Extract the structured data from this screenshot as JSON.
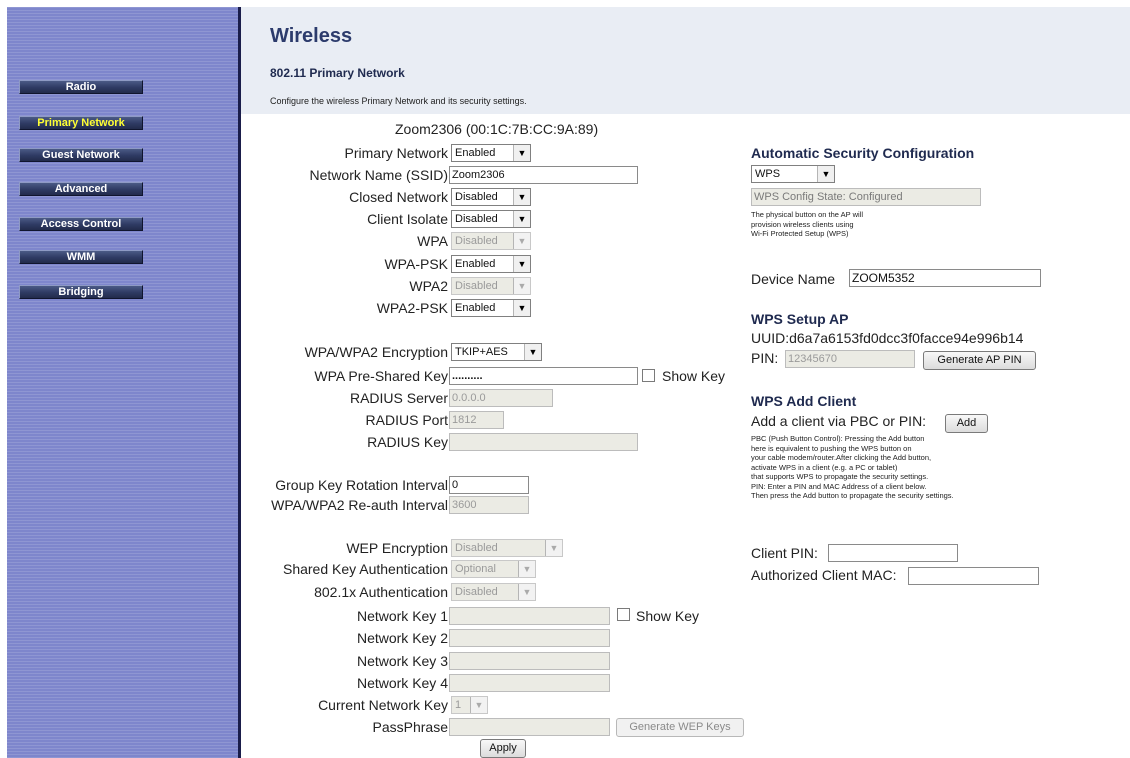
{
  "sidebar": {
    "items": [
      {
        "label": "Radio",
        "active": false
      },
      {
        "label": "Primary Network",
        "active": true
      },
      {
        "label": "Guest Network",
        "active": false
      },
      {
        "label": "Advanced",
        "active": false
      },
      {
        "label": "Access Control",
        "active": false
      },
      {
        "label": "WMM",
        "active": false
      },
      {
        "label": "Bridging",
        "active": false
      }
    ]
  },
  "header": {
    "title": "Wireless",
    "section": "802.11 Primary Network",
    "description": "Configure the wireless Primary Network and its security settings."
  },
  "form": {
    "network_info": "Zoom2306 (00:1C:7B:CC:9A:89)",
    "primary_network": {
      "label": "Primary Network",
      "value": "Enabled"
    },
    "ssid": {
      "label": "Network Name (SSID)",
      "value": "Zoom2306"
    },
    "closed_network": {
      "label": "Closed Network",
      "value": "Disabled"
    },
    "client_isolate": {
      "label": "Client Isolate",
      "value": "Disabled"
    },
    "wpa": {
      "label": "WPA",
      "value": "Disabled"
    },
    "wpa_psk": {
      "label": "WPA-PSK",
      "value": "Enabled"
    },
    "wpa2": {
      "label": "WPA2",
      "value": "Disabled"
    },
    "wpa2_psk": {
      "label": "WPA2-PSK",
      "value": "Enabled"
    },
    "encryption": {
      "label": "WPA/WPA2 Encryption",
      "value": "TKIP+AES"
    },
    "psk": {
      "label": "WPA Pre-Shared Key",
      "value": "..........",
      "show_key": "Show Key"
    },
    "radius_server": {
      "label": "RADIUS Server",
      "value": "0.0.0.0"
    },
    "radius_port": {
      "label": "RADIUS Port",
      "value": "1812"
    },
    "radius_key": {
      "label": "RADIUS Key",
      "value": ""
    },
    "group_key": {
      "label": "Group Key Rotation Interval",
      "value": "0"
    },
    "reauth": {
      "label": "WPA/WPA2 Re-auth Interval",
      "value": "3600"
    },
    "wep_encryption": {
      "label": "WEP Encryption",
      "value": "Disabled"
    },
    "shared_key_auth": {
      "label": "Shared Key Authentication",
      "value": "Optional"
    },
    "dot1x_auth": {
      "label": "802.1x Authentication",
      "value": "Disabled"
    },
    "network_keys": [
      {
        "label": "Network Key 1",
        "value": ""
      },
      {
        "label": "Network Key 2",
        "value": ""
      },
      {
        "label": "Network Key 3",
        "value": ""
      },
      {
        "label": "Network Key 4",
        "value": ""
      }
    ],
    "wep_show_key": "Show Key",
    "current_key": {
      "label": "Current Network Key",
      "value": "1"
    },
    "passphrase": {
      "label": "PassPhrase",
      "value": ""
    },
    "generate_wep_keys": "Generate WEP Keys",
    "apply": "Apply"
  },
  "wps": {
    "auto_config_title": "Automatic Security Configuration",
    "method": "WPS",
    "config_state": "WPS Config State: Configured",
    "auto_desc": "The physical button on the AP will\nprovision wireless clients using\nWi-Fi Protected Setup (WPS)",
    "device_name_label": "Device Name",
    "device_name": "ZOOM5352",
    "setup_ap_title": "WPS Setup AP",
    "uuid": "UUID:d6a7a6153fd0dcc3f0facce94e996b14",
    "pin_label": "PIN:",
    "pin": "12345670",
    "generate_pin": "Generate AP PIN",
    "add_client_title": "WPS Add Client",
    "add_client_text": "Add a client via PBC or PIN:",
    "add_button": "Add",
    "add_desc": "PBC (Push Button Control): Pressing the Add button\nhere is equivalent to pushing the WPS button on\nyour cable modem/router.After clicking the Add button,\nactivate WPS in a client (e.g. a PC or tablet)\nthat supports WPS to propagate the security settings.\nPIN: Enter a PIN and MAC Address of a client below.\nThen press the Add button to propagate the security settings.",
    "client_pin_label": "Client PIN:",
    "client_pin": "",
    "client_mac_label": "Authorized Client MAC:",
    "client_mac": ""
  }
}
